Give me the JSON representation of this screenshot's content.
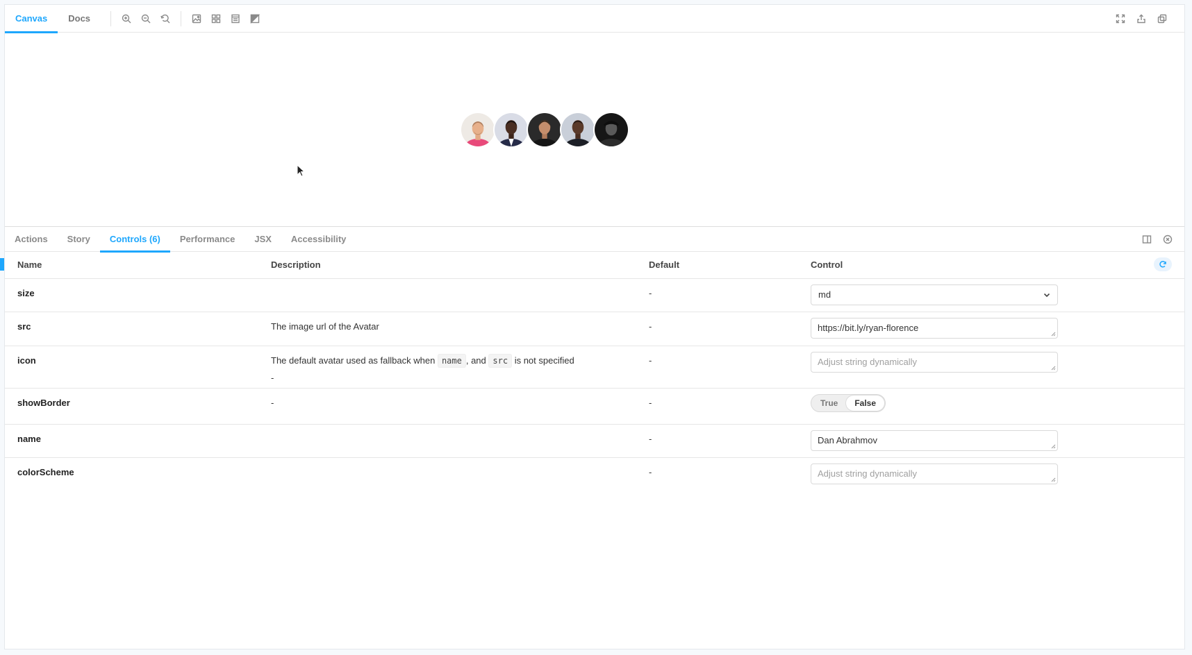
{
  "toolbar": {
    "tabs": [
      {
        "label": "Canvas",
        "active": true
      },
      {
        "label": "Docs",
        "active": false
      }
    ],
    "tools": [
      "zoom-in-icon",
      "zoom-out-icon",
      "zoom-reset-icon",
      "background-icon",
      "grid-icon",
      "viewport-icon",
      "outline-icon"
    ],
    "right_tools": [
      "fullscreen-icon",
      "share-icon",
      "copy-link-icon"
    ]
  },
  "canvas": {
    "avatars": [
      {
        "name": "avatar-1",
        "bg": "#e8e2dc",
        "shirt": "#e84a7a",
        "skin": "#e7b08b"
      },
      {
        "name": "avatar-2",
        "bg": "#d8dde8",
        "shirt": "#2a3050",
        "skin": "#4a2e22"
      },
      {
        "name": "avatar-3",
        "bg": "#2b2b2b",
        "shirt": "#1a1a1a",
        "skin": "#c58e6c"
      },
      {
        "name": "avatar-4",
        "bg": "#c9cfd9",
        "shirt": "#1c1f26",
        "skin": "#5a3a2a"
      },
      {
        "name": "avatar-5",
        "bg": "#1a1a1a",
        "shirt": "#2a2a2a",
        "skin": "#6a6a6a"
      }
    ]
  },
  "panel": {
    "tabs": [
      {
        "label": "Actions",
        "active": false
      },
      {
        "label": "Story",
        "active": false
      },
      {
        "label": "Controls (6)",
        "active": true
      },
      {
        "label": "Performance",
        "active": false
      },
      {
        "label": "JSX",
        "active": false
      },
      {
        "label": "Accessibility",
        "active": false
      }
    ]
  },
  "table": {
    "headers": {
      "name": "Name",
      "description": "Description",
      "default": "Default",
      "control": "Control"
    },
    "rows": {
      "size": {
        "name": "size",
        "description": "",
        "default": "-",
        "control_value": "md"
      },
      "src": {
        "name": "src",
        "description": "The image url of the Avatar",
        "default": "-",
        "control_value": "https://bit.ly/ryan-florence"
      },
      "icon": {
        "name": "icon",
        "desc_before": "The default avatar used as fallback when",
        "code1": "name",
        "desc_mid": ", and",
        "code2": "src",
        "desc_after": "is not specified",
        "desc_extra": "-",
        "default": "-",
        "placeholder": "Adjust string dynamically"
      },
      "showBorder": {
        "name": "showBorder",
        "description": "-",
        "default": "-",
        "true_label": "True",
        "false_label": "False",
        "selected": "False"
      },
      "name": {
        "name": "name",
        "description": "",
        "default": "-",
        "control_value": "Dan Abrahmov"
      },
      "colorScheme": {
        "name": "colorScheme",
        "description": "",
        "default": "-",
        "placeholder": "Adjust string dynamically"
      }
    }
  },
  "colors": {
    "accent": "#1ea7fd"
  }
}
